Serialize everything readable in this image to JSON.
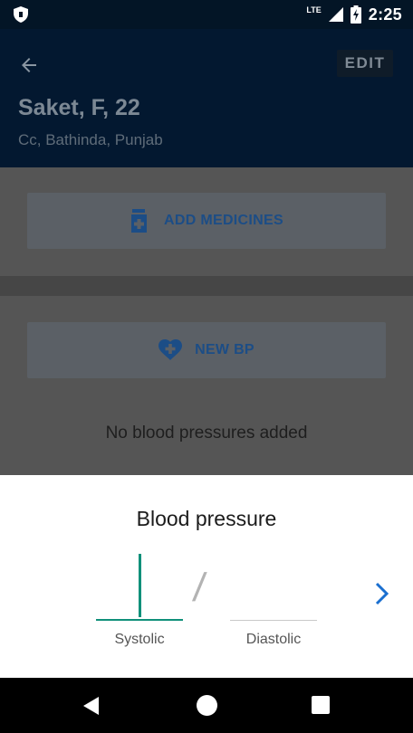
{
  "status_bar": {
    "network_type": "LTE",
    "time": "2:25"
  },
  "header": {
    "edit_label": "EDIT",
    "patient_name": "Saket, F, 22",
    "patient_location": "Cc, Bathinda, Punjab"
  },
  "medicines": {
    "button_label": "ADD MEDICINES",
    "icon": "add-medicine-icon"
  },
  "blood_pressure_card": {
    "button_label": "NEW BP",
    "icon": "heart-plus-icon",
    "empty_text": "No blood pressures added"
  },
  "bp_sheet": {
    "title": "Blood pressure",
    "systolic_label": "Systolic",
    "diastolic_label": "Diastolic",
    "separator": "/"
  },
  "colors": {
    "header_bg": "#031830",
    "accent_teal": "#10907a",
    "link_blue": "#1a6fd0"
  }
}
